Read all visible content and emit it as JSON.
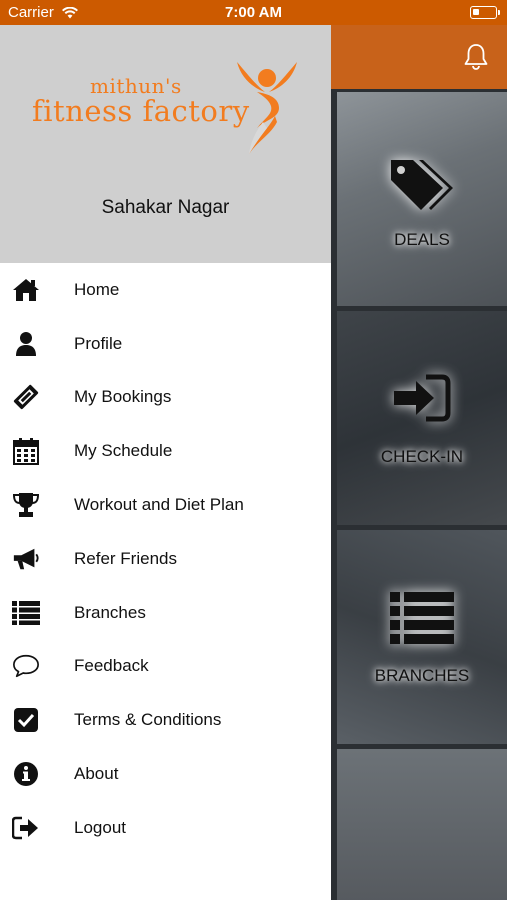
{
  "status_bar": {
    "carrier": "Carrier",
    "time": "7:00 AM",
    "battery_level": 0.3
  },
  "drawer": {
    "logo": {
      "line1": "mithun's",
      "line2": "fitness factory"
    },
    "location": "Sahakar Nagar",
    "menu": [
      {
        "label": "Home",
        "icon": "home-icon"
      },
      {
        "label": "Profile",
        "icon": "user-icon"
      },
      {
        "label": "My Bookings",
        "icon": "ticket-icon"
      },
      {
        "label": "My Schedule",
        "icon": "calendar-icon"
      },
      {
        "label": "Workout and Diet Plan",
        "icon": "trophy-icon"
      },
      {
        "label": "Refer Friends",
        "icon": "megaphone-icon"
      },
      {
        "label": "Branches",
        "icon": "list-icon"
      },
      {
        "label": "Feedback",
        "icon": "speech-bubble-icon"
      },
      {
        "label": "Terms & Conditions",
        "icon": "checkbox-icon"
      },
      {
        "label": "About",
        "icon": "info-icon"
      },
      {
        "label": "Logout",
        "icon": "logout-icon"
      }
    ]
  },
  "main": {
    "tiles": [
      {
        "label": "DEALS",
        "icon": "tags-icon"
      },
      {
        "label": "CHECK-IN",
        "icon": "sign-in-icon"
      },
      {
        "label": "BRANCHES",
        "icon": "list-icon"
      }
    ]
  },
  "colors": {
    "accent": "#cc5a00",
    "brand_orange": "#f27c1f",
    "drawer_header": "#cfcfcf"
  }
}
